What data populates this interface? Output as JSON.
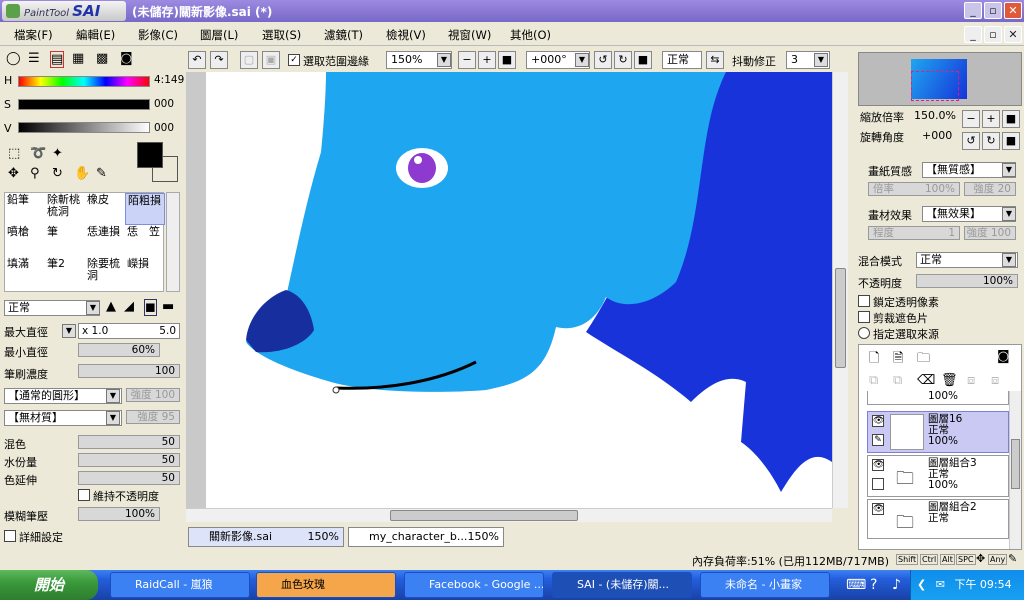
{
  "window": {
    "app_name": "PaintTool",
    "app_brand": "SAI",
    "title": "(未儲存)關新影像.sai (*)"
  },
  "menu": [
    "檔案(F)",
    "編輯(E)",
    "影像(C)",
    "圖層(L)",
    "選取(S)",
    "濾鏡(T)",
    "檢視(V)",
    "視窗(W)",
    "其他(O)"
  ],
  "color": {
    "h_label": "H",
    "h_value": "4:149",
    "s_label": "S",
    "s_value": "000",
    "v_label": "V",
    "v_value": "000",
    "fg": "#000000",
    "bg": "#ffffff"
  },
  "tools": [
    "鉛筆",
    "除斬桃梳洞",
    "橡皮",
    "陌粗損",
    "噴槍",
    "筆",
    "恁連損",
    "恁　笠",
    "填滿",
    "筆2",
    "除要梳洞",
    "嶸損"
  ],
  "brush": {
    "mode": "正常",
    "max_diameter_label": "最大直徑",
    "max_diameter_mult": "x 1.0",
    "max_diameter_value": "5.0",
    "min_diameter_label": "最小直徑",
    "min_diameter_value": "60%",
    "density_label": "筆刷濃度",
    "density_value": "100",
    "shape": "【通常的圓形】",
    "shape_strength_label": "強度",
    "shape_strength": "100",
    "texture": "【無材質】",
    "texture_strength_label": "強度",
    "texture_strength": "95",
    "blend_label": "混色",
    "blend": "50",
    "water_label": "水份量",
    "water": "50",
    "stretch_label": "色延伸",
    "stretch": "50",
    "keep_opacity": "維持不透明度",
    "blur_label": "模糊筆壓",
    "blur": "100%",
    "detail": "詳細設定"
  },
  "toolbar": {
    "selection_edge": "選取范圍邊緣",
    "zoom": "150%",
    "rotation": "+000°",
    "mode": "正常",
    "stabilizer_label": "抖動修正",
    "stabilizer": "3"
  },
  "navigator": {
    "zoom_label": "縮放倍率",
    "zoom": "150.0%",
    "rotation_label": "旋轉角度",
    "rotation": "+000"
  },
  "paper": {
    "texture_label": "畫紙質感",
    "texture": "【無質感】",
    "scale_label": "倍率",
    "scale": "100%",
    "strength_label": "強度",
    "strength": "20",
    "effect_label": "畫材效果",
    "effect": "【無效果】",
    "level_label": "程度",
    "level": "1",
    "effect_strength_label": "強度",
    "effect_strength": "100"
  },
  "layer_props": {
    "blend_label": "混合模式",
    "blend": "正常",
    "opacity_label": "不透明度",
    "opacity": "100%",
    "lock": "鎖定透明像素",
    "clip": "剪裁遮色片",
    "select_source": "指定選取來源"
  },
  "layers": [
    {
      "name": "",
      "mode": "",
      "opacity": "100%"
    },
    {
      "name": "圖層16",
      "mode": "正常",
      "opacity": "100%"
    },
    {
      "name": "圖層組合3",
      "mode": "正常",
      "opacity": "100%"
    },
    {
      "name": "圖層組合2",
      "mode": "正常",
      "opacity": ""
    }
  ],
  "doc_tabs": [
    {
      "name": "關新影像.sai",
      "zoom": "150%"
    },
    {
      "name": "my_character_b...",
      "zoom": "150%"
    }
  ],
  "status": {
    "memory": "內存負荷率:51% (已用112MB/717MB)",
    "keys": [
      "Shift",
      "Ctrl",
      "Alt",
      "SPC",
      "Any"
    ]
  },
  "taskbar": {
    "start": "開始",
    "tasks": [
      "RaidCall - 嵐狼",
      "血色玫瑰",
      "Facebook - Google ...",
      "SAI - (未儲存)關...",
      "未命名 - 小畫家"
    ],
    "clock": "下午 09:54"
  },
  "colors": {
    "title": "#8577d4",
    "selected_layer": "#c9c9f3",
    "fur_light": "#1fa6f0",
    "fur_dark": "#1733d9"
  }
}
